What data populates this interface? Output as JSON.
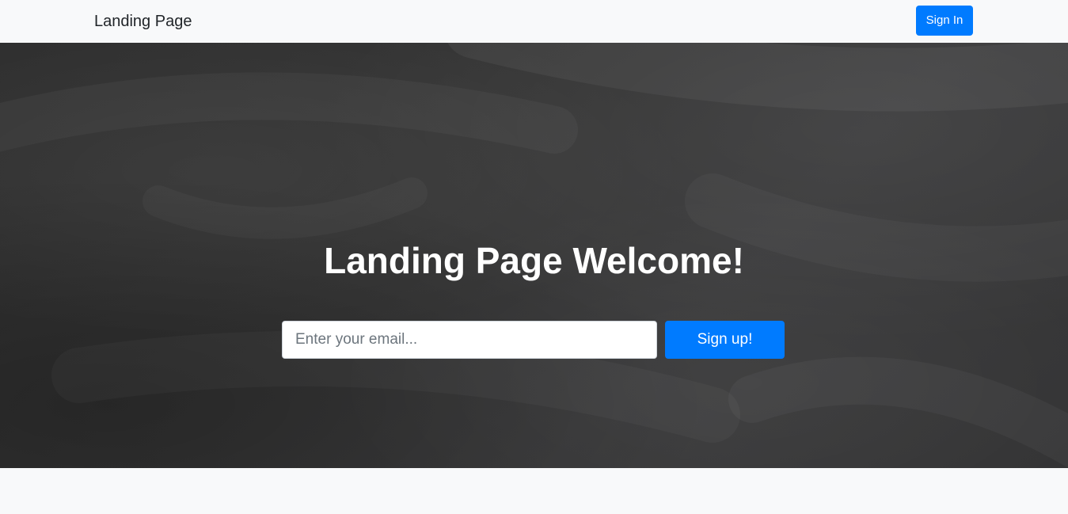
{
  "navbar": {
    "brand": "Landing Page",
    "signin_label": "Sign In"
  },
  "hero": {
    "title": "Landing Page Welcome!",
    "email_placeholder": "Enter your email...",
    "email_value": "",
    "signup_label": "Sign up!"
  },
  "colors": {
    "accent": "#007bff",
    "navbar_bg": "#f8f9fa",
    "hero_bg": "#333333",
    "text_light": "#ffffff",
    "text_dark": "#212529"
  }
}
